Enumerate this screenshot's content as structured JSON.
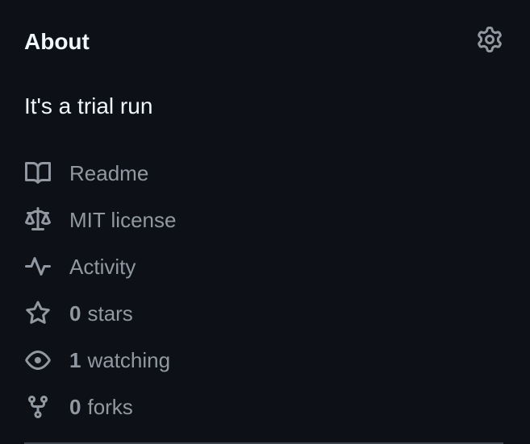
{
  "about": {
    "title": "About",
    "description": "It's a trial run",
    "settings_icon": "gear-icon"
  },
  "items": [
    {
      "icon": "book-icon",
      "label": "Readme"
    },
    {
      "icon": "law-icon",
      "label": "MIT license"
    },
    {
      "icon": "pulse-icon",
      "label": "Activity"
    },
    {
      "icon": "star-icon",
      "count": "0",
      "label": "stars"
    },
    {
      "icon": "eye-icon",
      "count": "1",
      "label": "watching"
    },
    {
      "icon": "repo-forked-icon",
      "count": "0",
      "label": "forks"
    }
  ],
  "colors": {
    "background": "#0d1117",
    "heading": "#f0f6fc",
    "muted": "#9198a1"
  }
}
